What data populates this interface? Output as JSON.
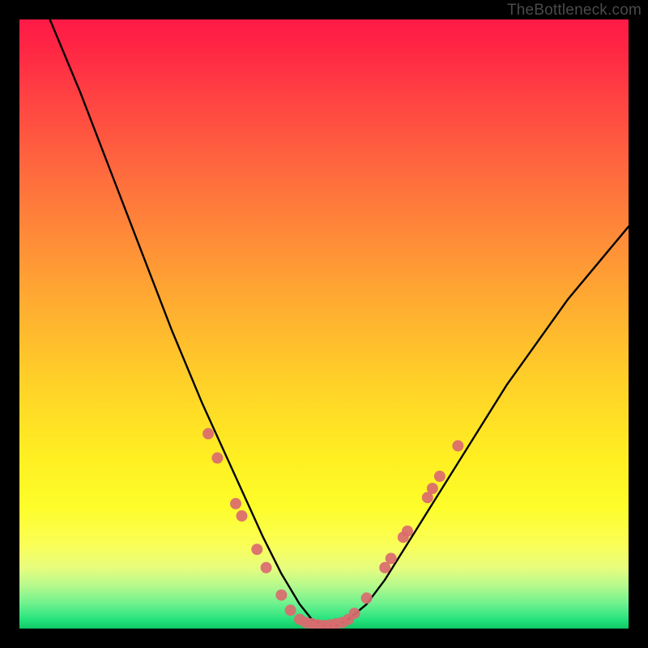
{
  "watermark": "TheBottleneck.com",
  "chart_data": {
    "type": "line",
    "title": "",
    "xlabel": "",
    "ylabel": "",
    "xlim": [
      0,
      100
    ],
    "ylim": [
      0,
      100
    ],
    "background": {
      "gradient_stops": [
        {
          "pos": 0,
          "color": "#ff1a46",
          "meaning": "severe bottleneck"
        },
        {
          "pos": 50,
          "color": "#ffc229",
          "meaning": "moderate"
        },
        {
          "pos": 80,
          "color": "#fbfe55",
          "meaning": "mild"
        },
        {
          "pos": 100,
          "color": "#0fc766",
          "meaning": "balanced"
        }
      ]
    },
    "series": [
      {
        "name": "bottleneck-curve",
        "color": "#000000",
        "x": [
          5,
          10,
          15,
          20,
          25,
          30,
          35,
          40,
          43,
          46,
          48,
          50,
          52,
          54,
          57,
          60,
          65,
          70,
          75,
          80,
          85,
          90,
          95,
          100
        ],
        "values": [
          100,
          88,
          75,
          62,
          49,
          37,
          26,
          15,
          9,
          4,
          1.5,
          0.5,
          0.5,
          1.5,
          4,
          8,
          16,
          24,
          32,
          40,
          47,
          54,
          60,
          66
        ]
      }
    ],
    "markers": {
      "name": "data-dots",
      "color": "#da6a6f",
      "radius_px": 7,
      "points": [
        {
          "x": 31.0,
          "y": 32.0
        },
        {
          "x": 32.5,
          "y": 28.0
        },
        {
          "x": 35.5,
          "y": 20.5
        },
        {
          "x": 36.5,
          "y": 18.5
        },
        {
          "x": 39.0,
          "y": 13.0
        },
        {
          "x": 40.5,
          "y": 10.0
        },
        {
          "x": 43.0,
          "y": 5.5
        },
        {
          "x": 44.5,
          "y": 3.0
        },
        {
          "x": 46.0,
          "y": 1.5
        },
        {
          "x": 47.0,
          "y": 1.0
        },
        {
          "x": 48.0,
          "y": 0.8
        },
        {
          "x": 49.0,
          "y": 0.6
        },
        {
          "x": 50.0,
          "y": 0.5
        },
        {
          "x": 51.0,
          "y": 0.6
        },
        {
          "x": 52.0,
          "y": 0.8
        },
        {
          "x": 53.0,
          "y": 1.0
        },
        {
          "x": 54.0,
          "y": 1.5
        },
        {
          "x": 55.0,
          "y": 2.5
        },
        {
          "x": 57.0,
          "y": 5.0
        },
        {
          "x": 60.0,
          "y": 10.0
        },
        {
          "x": 61.0,
          "y": 11.5
        },
        {
          "x": 63.0,
          "y": 15.0
        },
        {
          "x": 63.7,
          "y": 16.0
        },
        {
          "x": 67.0,
          "y": 21.5
        },
        {
          "x": 67.8,
          "y": 23.0
        },
        {
          "x": 69.0,
          "y": 25.0
        },
        {
          "x": 72.0,
          "y": 30.0
        }
      ]
    }
  }
}
